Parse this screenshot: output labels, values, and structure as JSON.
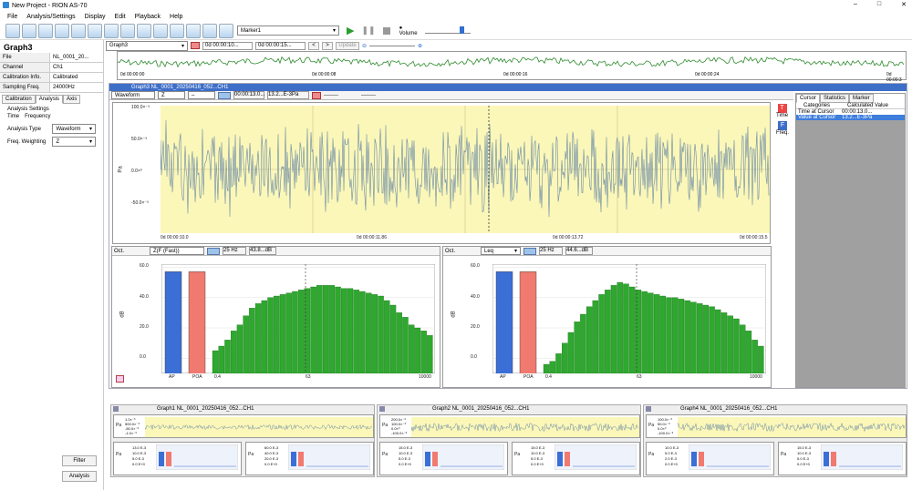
{
  "window": {
    "title": "New Project - RION AS-70"
  },
  "menu": [
    "File",
    "Analysis/Settings",
    "Display",
    "Edit",
    "Playback",
    "Help"
  ],
  "toolbar": {
    "marker_select": "Marker1",
    "volume_label": "Volume"
  },
  "graph_select": {
    "value": "Graph3",
    "time_start": "0d 00:00:10...",
    "time_end": "0d 00:00:15...",
    "prev": "<",
    "next": ">",
    "update": "Update"
  },
  "overview": {
    "ticks": [
      "0d 00:00:00",
      "0d 00:00:08",
      "0d 00:00:16",
      "0d 00:00:24",
      "0d 00:00:3"
    ]
  },
  "left_panel": {
    "title": "Graph3",
    "props": [
      {
        "k": "File",
        "v": "NL_0001_20..."
      },
      {
        "k": "Channel",
        "v": "Ch1"
      },
      {
        "k": "Calibration Info.",
        "v": "Calibrated"
      },
      {
        "k": "Sampling Freq.",
        "v": "24000Hz"
      }
    ],
    "tabs": [
      "Calibration",
      "Analysis",
      "Axis"
    ],
    "settings_title": "Analysis Settings",
    "subtabs": [
      "Time",
      "Frequency"
    ],
    "analysis_type_label": "Analysis Type",
    "analysis_type": "Waveform",
    "freq_weight_label": "Freq. Weighting",
    "freq_weight": "Z",
    "filter": "Filter",
    "analysis": "Analysis"
  },
  "graph3": {
    "title": "Graph3 NL_0001_20250416_052...CH1",
    "wave_type": "Waveform",
    "weight": "Z",
    "dash": "–",
    "time": "00:00:13.0...",
    "value": "13.2...E-3Pa",
    "d1": "--------",
    "d2": "--------",
    "y_axis_label": "Pa",
    "y_ticks": [
      "100.0×⁻³",
      "50.0×⁻³",
      "0.0×⁰",
      "-50.0×⁻³"
    ],
    "x_ticks": [
      "0d 00:00:10.0",
      "0d 00:00:11.86",
      "0d 00:00:13.72",
      "0d 00:00:15.5"
    ],
    "time_btn": "Time",
    "freq_btn": "Freq."
  },
  "cursor_panel": {
    "tabs": [
      "Cursor",
      "Statistics",
      "Marker"
    ],
    "headers": [
      "Categories",
      "Calculated Value"
    ],
    "rows": [
      {
        "k": "Time at Cursor",
        "v": "00:00:13.0..."
      },
      {
        "k": "Value at Cursor",
        "v": "13.2...E-3Pa"
      }
    ]
  },
  "spec_left": {
    "band": "Oct.",
    "weight": "Z(F (Fast))",
    "freq": "25 Hz",
    "level": "43.8...dB",
    "y_axis_label": "dB",
    "y_ticks": [
      "60.0",
      "40.0",
      "20.0",
      "0.0"
    ],
    "x_ticks": [
      "AP",
      "POA",
      "0.4",
      "63",
      "10000"
    ]
  },
  "spec_right": {
    "band": "Oct.",
    "weight": "Leq",
    "freq": "25 Hz",
    "level": "44.6...dB",
    "y_axis_label": "dB",
    "y_ticks": [
      "60.0",
      "40.0",
      "20.0",
      "0.0"
    ],
    "x_ticks": [
      "AP",
      "POA",
      "0.4",
      "63",
      "10000"
    ]
  },
  "mini_graphs": [
    {
      "title": "Graph1 NL_0001_20250416_052...CH1",
      "y_label": "Pa",
      "y_ticks": [
        "1.0×⁻³",
        "500.0×⁻³",
        "-50.0×⁻³",
        "-1.0×⁻³"
      ],
      "spec": [
        "13.0 E-3",
        "10.0 E-3",
        "5.0 E-3",
        "0.0 E+0"
      ],
      "spec2": [
        "60.0 E-3",
        "40.0 E-3",
        "20.0 E-3",
        "0.0 E+0"
      ]
    },
    {
      "title": "Graph2 NL_0001_20250416_052...CH1",
      "y_label": "Pa",
      "y_ticks": [
        "200.0×⁻³",
        "100.0×⁻³",
        "0.0×⁰",
        "-100.0×⁻³"
      ],
      "spec": [
        "15.0 E-3",
        "10.0 E-3",
        "5.0 E-3",
        "0.0 E+0"
      ],
      "spec2": [
        "15.0 E-3",
        "10.0 E-3",
        "5.0 E-3",
        "0.0 E+0"
      ]
    },
    {
      "title": "Graph4 NL_0001_20250416_052...CH1",
      "y_label": "Pa",
      "y_ticks": [
        "100.0×⁻³",
        "50.0×⁻³",
        "0.0×⁰",
        "-100.0×⁻³"
      ],
      "spec": [
        "10.0 E-3",
        "5.0 E-3",
        "2.0 E-3",
        "0.0 E+0"
      ],
      "spec2": [
        "15.0 E-3",
        "10.0 E-3",
        "5.0 E-3",
        "0.0 E+0"
      ]
    }
  ],
  "colors": {
    "ap": "#3b6fd6",
    "poa": "#f07a70",
    "bar": "#2ea82e",
    "wave": "#6a8aa8",
    "plotbg": "#fbf7b8",
    "accent": "#3d6ec8"
  },
  "chart_data": [
    {
      "type": "bar",
      "title": "",
      "categories": [
        "AP",
        "POA"
      ],
      "values": [
        57,
        57
      ],
      "ylim": [
        -10,
        62
      ],
      "note": "overall bars"
    },
    {
      "type": "bar",
      "title": "",
      "series": [
        {
          "values": [
            5,
            8,
            12,
            18,
            22,
            28,
            33,
            36,
            38,
            40,
            41,
            42,
            43,
            44,
            45,
            46,
            47,
            48,
            48,
            48,
            47,
            46,
            46,
            45,
            44,
            43,
            42,
            41,
            38,
            35,
            30,
            27,
            22,
            20,
            18,
            15
          ]
        }
      ],
      "ylim": [
        -10,
        62
      ]
    },
    {
      "type": "bar",
      "title": "",
      "categories": [
        "AP",
        "POA"
      ],
      "values": [
        57,
        57
      ],
      "ylim": [
        -10,
        62
      ]
    },
    {
      "type": "bar",
      "title": "",
      "series": [
        {
          "values": [
            -4,
            -2,
            3,
            10,
            17,
            24,
            29,
            34,
            38,
            42,
            45,
            48,
            50,
            49,
            47,
            45,
            44,
            43,
            42,
            41,
            40,
            40,
            39,
            38,
            37,
            36,
            35,
            34,
            32,
            30,
            28,
            26,
            22,
            18,
            12,
            8
          ]
        }
      ],
      "ylim": [
        -10,
        62
      ]
    }
  ]
}
